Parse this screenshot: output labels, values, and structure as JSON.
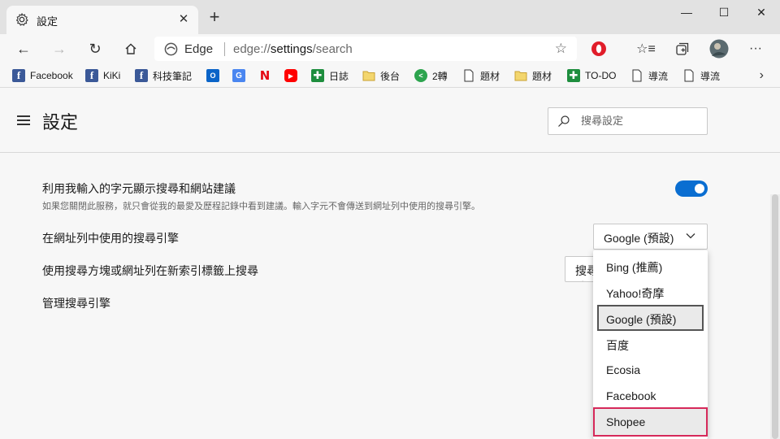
{
  "window": {
    "tab_title": "設定",
    "new_tab": "+",
    "minimize": "—",
    "maximize": "☐",
    "close": "✕"
  },
  "address_bar": {
    "site_label": "Edge",
    "url_prefix": "edge://",
    "url_host": "settings",
    "url_path": "/search"
  },
  "favorites": [
    {
      "label": "Facebook",
      "icon": "facebook-icon"
    },
    {
      "label": "KiKi",
      "icon": "facebook-icon"
    },
    {
      "label": "科技筆記",
      "icon": "facebook-icon"
    },
    {
      "label": "",
      "icon": "outlook-icon"
    },
    {
      "label": "",
      "icon": "google-translate-icon"
    },
    {
      "label": "",
      "icon": "netflix-icon"
    },
    {
      "label": "",
      "icon": "youtube-icon"
    },
    {
      "label": "日誌",
      "icon": "green-plus-icon"
    },
    {
      "label": "後台",
      "icon": "folder-icon"
    },
    {
      "label": "2轉",
      "icon": "share-icon"
    },
    {
      "label": "題材",
      "icon": "document-icon"
    },
    {
      "label": "題材",
      "icon": "folder-icon"
    },
    {
      "label": "TO-DO",
      "icon": "green-plus-icon"
    },
    {
      "label": "導流",
      "icon": "document-icon"
    },
    {
      "label": "導流",
      "icon": "document-icon"
    }
  ],
  "page": {
    "title": "設定",
    "search_placeholder": "搜尋設定"
  },
  "settings": {
    "suggestions_label": "利用我輸入的字元顯示搜尋和網站建議",
    "suggestions_desc": "如果您關閉此服務，就只會從我的最愛及歷程記錄中看到建議。輸入字元不會傳送到網址列中使用的搜尋引擎。",
    "suggestions_enabled": true,
    "engine_label": "在網址列中使用的搜尋引擎",
    "engine_value": "Google (預設)",
    "newtab_label": "使用搜尋方塊或網址列在新索引標籤上搜尋",
    "newtab_button": "搜尋方塊",
    "manage_label": "管理搜尋引擎"
  },
  "dropdown": {
    "options": [
      "Bing (推薦)",
      "Yahoo!奇摩",
      "Google (預設)",
      "百度",
      "Ecosia",
      "Facebook",
      "Shopee"
    ],
    "selected": "Google (預設)",
    "highlighted": "Shopee"
  },
  "colors": {
    "accent": "#0a6ed1",
    "highlight_border": "#d6295a"
  }
}
